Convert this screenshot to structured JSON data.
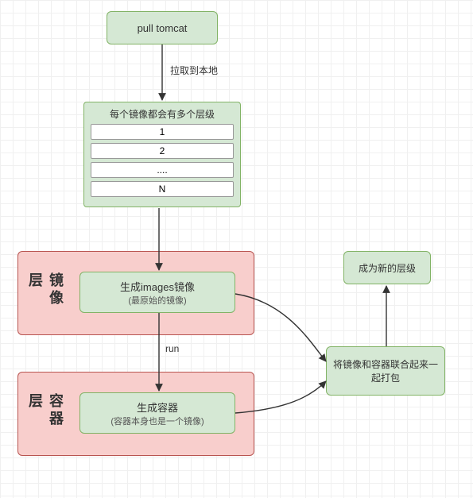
{
  "nodes": {
    "pull_tomcat": {
      "label": "pull tomcat"
    },
    "layers_box": {
      "title": "每个镜像都会有多个层级",
      "items": [
        "1",
        "2",
        "....",
        "N"
      ]
    },
    "gen_images": {
      "line1": "生成images镜像",
      "line2": "(最原始的镜像)"
    },
    "gen_container": {
      "line1": "生成容器",
      "line2": "(容器本身也是一个镜像)"
    },
    "combine": {
      "label": "将镜像和容器联合起来一起打包"
    },
    "new_layer": {
      "label": "成为新的层级"
    }
  },
  "containers": {
    "image_layer": {
      "label": "镜像层"
    },
    "container_layer": {
      "label": "容器层"
    }
  },
  "edges": {
    "pull_to_layers": {
      "label": "拉取到本地"
    },
    "images_to_container": {
      "label": "run"
    }
  }
}
